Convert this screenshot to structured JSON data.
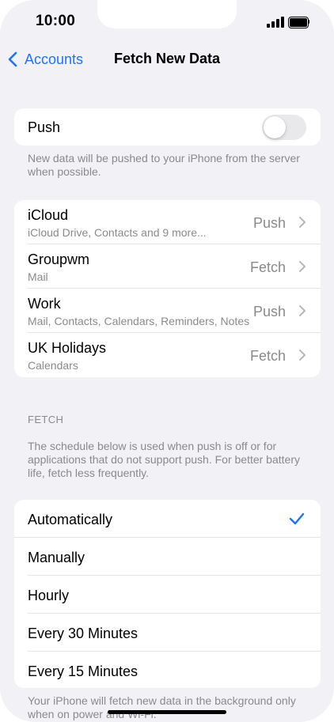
{
  "status": {
    "time": "10:00"
  },
  "nav": {
    "back_label": "Accounts",
    "title": "Fetch New Data"
  },
  "push": {
    "label": "Push",
    "enabled": false,
    "footer": "New data will be pushed to your iPhone from the server when possible."
  },
  "accounts": [
    {
      "name": "iCloud",
      "detail": "iCloud Drive, Contacts and 9 more...",
      "mode": "Push"
    },
    {
      "name": "Groupwm",
      "detail": "Mail",
      "mode": "Fetch"
    },
    {
      "name": "Work",
      "detail": "Mail, Contacts, Calendars, Reminders, Notes",
      "mode": "Push"
    },
    {
      "name": "UK Holidays",
      "detail": "Calendars",
      "mode": "Fetch"
    }
  ],
  "fetch": {
    "header": "FETCH",
    "description": "The schedule below is used when push is off or for applications that do not support push. For better battery life, fetch less frequently.",
    "options": [
      "Automatically",
      "Manually",
      "Hourly",
      "Every 30 Minutes",
      "Every 15 Minutes"
    ],
    "selected": "Automatically",
    "footer": "Your iPhone will fetch new data in the background only when on power and Wi-Fi."
  },
  "colors": {
    "accent": "#1d74f5",
    "background": "#f1f1f6",
    "secondary_text": "#8a8a8e"
  }
}
